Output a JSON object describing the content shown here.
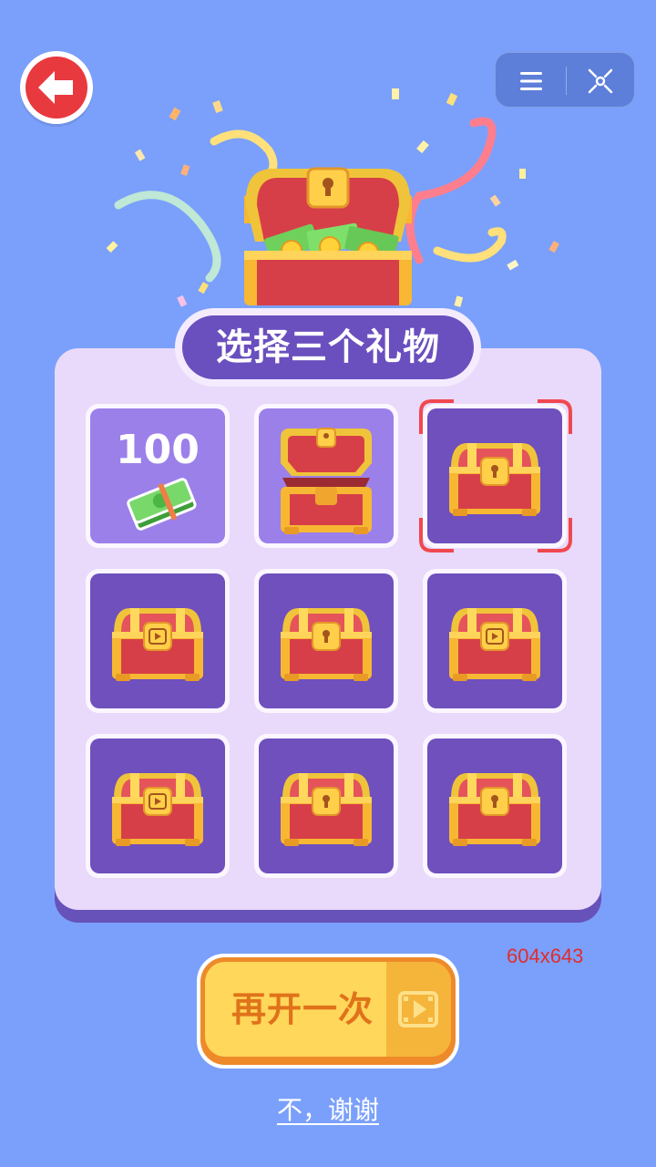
{
  "title": "选择三个礼物",
  "reward_amount": "100",
  "size_label": "604x643",
  "reopen_label": "再开一次",
  "decline_label": "不，谢谢",
  "icons": {
    "back": "arrow-left-icon",
    "menu": "menu-icon",
    "close": "target-close-icon",
    "video": "video-play-icon"
  },
  "grid": [
    {
      "state": "revealed",
      "content": "cash",
      "amount": "100"
    },
    {
      "state": "opened",
      "content": "empty"
    },
    {
      "state": "selected",
      "content": "locked"
    },
    {
      "state": "closed",
      "badge": "video"
    },
    {
      "state": "closed",
      "badge": "lock"
    },
    {
      "state": "closed",
      "badge": "video"
    },
    {
      "state": "closed",
      "badge": "video"
    },
    {
      "state": "closed",
      "badge": "lock"
    },
    {
      "state": "closed",
      "badge": "lock"
    }
  ],
  "colors": {
    "background": "#7aa0fb",
    "panel": "#e9d9fb",
    "tile": "#6f50bd",
    "tile_revealed": "#9b80ea",
    "accent_red": "#e8393f",
    "button_yellow": "#ffd75a",
    "button_text": "#e0721a"
  }
}
